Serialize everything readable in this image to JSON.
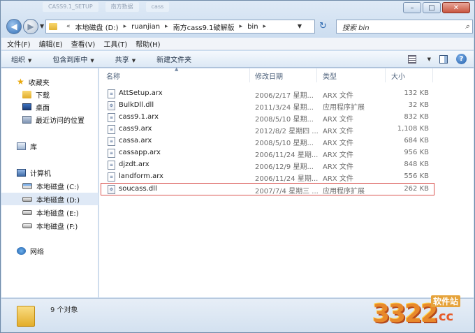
{
  "title_tabs": [
    "CASS9.1_SETUP",
    "南方数据",
    "cass"
  ],
  "address": {
    "crumbs": [
      "本地磁盘 (D:)",
      "ruanjian",
      "南方cass9.1破解版",
      "bin"
    ],
    "search_placeholder": "搜索 bin"
  },
  "menu": [
    "文件(F)",
    "编辑(E)",
    "查看(V)",
    "工具(T)",
    "帮助(H)"
  ],
  "toolbar": {
    "organize": "组织",
    "include_library": "包含到库中",
    "share": "共享",
    "new_folder": "新建文件夹"
  },
  "nav_pane": {
    "favorites": "收藏夹",
    "downloads": "下载",
    "desktop": "桌面",
    "recent": "最近访问的位置",
    "library": "库",
    "computer": "计算机",
    "drives": [
      "本地磁盘 (C:)",
      "本地磁盘 (D:)",
      "本地磁盘 (E:)",
      "本地磁盘 (F:)"
    ],
    "network": "网络"
  },
  "columns": {
    "name": "名称",
    "date": "修改日期",
    "type": "类型",
    "size": "大小"
  },
  "files": [
    {
      "name": "AttSetup.arx",
      "date": "2006/2/17 星期...",
      "type": "ARX 文件",
      "size": "132 KB"
    },
    {
      "name": "BulkDll.dll",
      "date": "2011/3/24 星期...",
      "type": "应用程序扩展",
      "size": "32 KB"
    },
    {
      "name": "cass9.1.arx",
      "date": "2008/5/10 星期...",
      "type": "ARX 文件",
      "size": "832 KB"
    },
    {
      "name": "cass9.arx",
      "date": "2012/8/2 星期四 ...",
      "type": "ARX 文件",
      "size": "1,108 KB"
    },
    {
      "name": "cassa.arx",
      "date": "2008/5/10 星期...",
      "type": "ARX 文件",
      "size": "684 KB"
    },
    {
      "name": "cassapp.arx",
      "date": "2006/11/24 星期...",
      "type": "ARX 文件",
      "size": "956 KB"
    },
    {
      "name": "djzdt.arx",
      "date": "2006/12/9 星期...",
      "type": "ARX 文件",
      "size": "848 KB"
    },
    {
      "name": "landform.arx",
      "date": "2006/11/24 星期...",
      "type": "ARX 文件",
      "size": "556 KB"
    },
    {
      "name": "soucass.dll",
      "date": "2007/7/4 星期三 ...",
      "type": "应用程序扩展",
      "size": "262 KB"
    }
  ],
  "status": {
    "count": "9 个对象"
  },
  "watermark": {
    "digits": "3322",
    "domain": ".cc",
    "cn": "软件站"
  }
}
